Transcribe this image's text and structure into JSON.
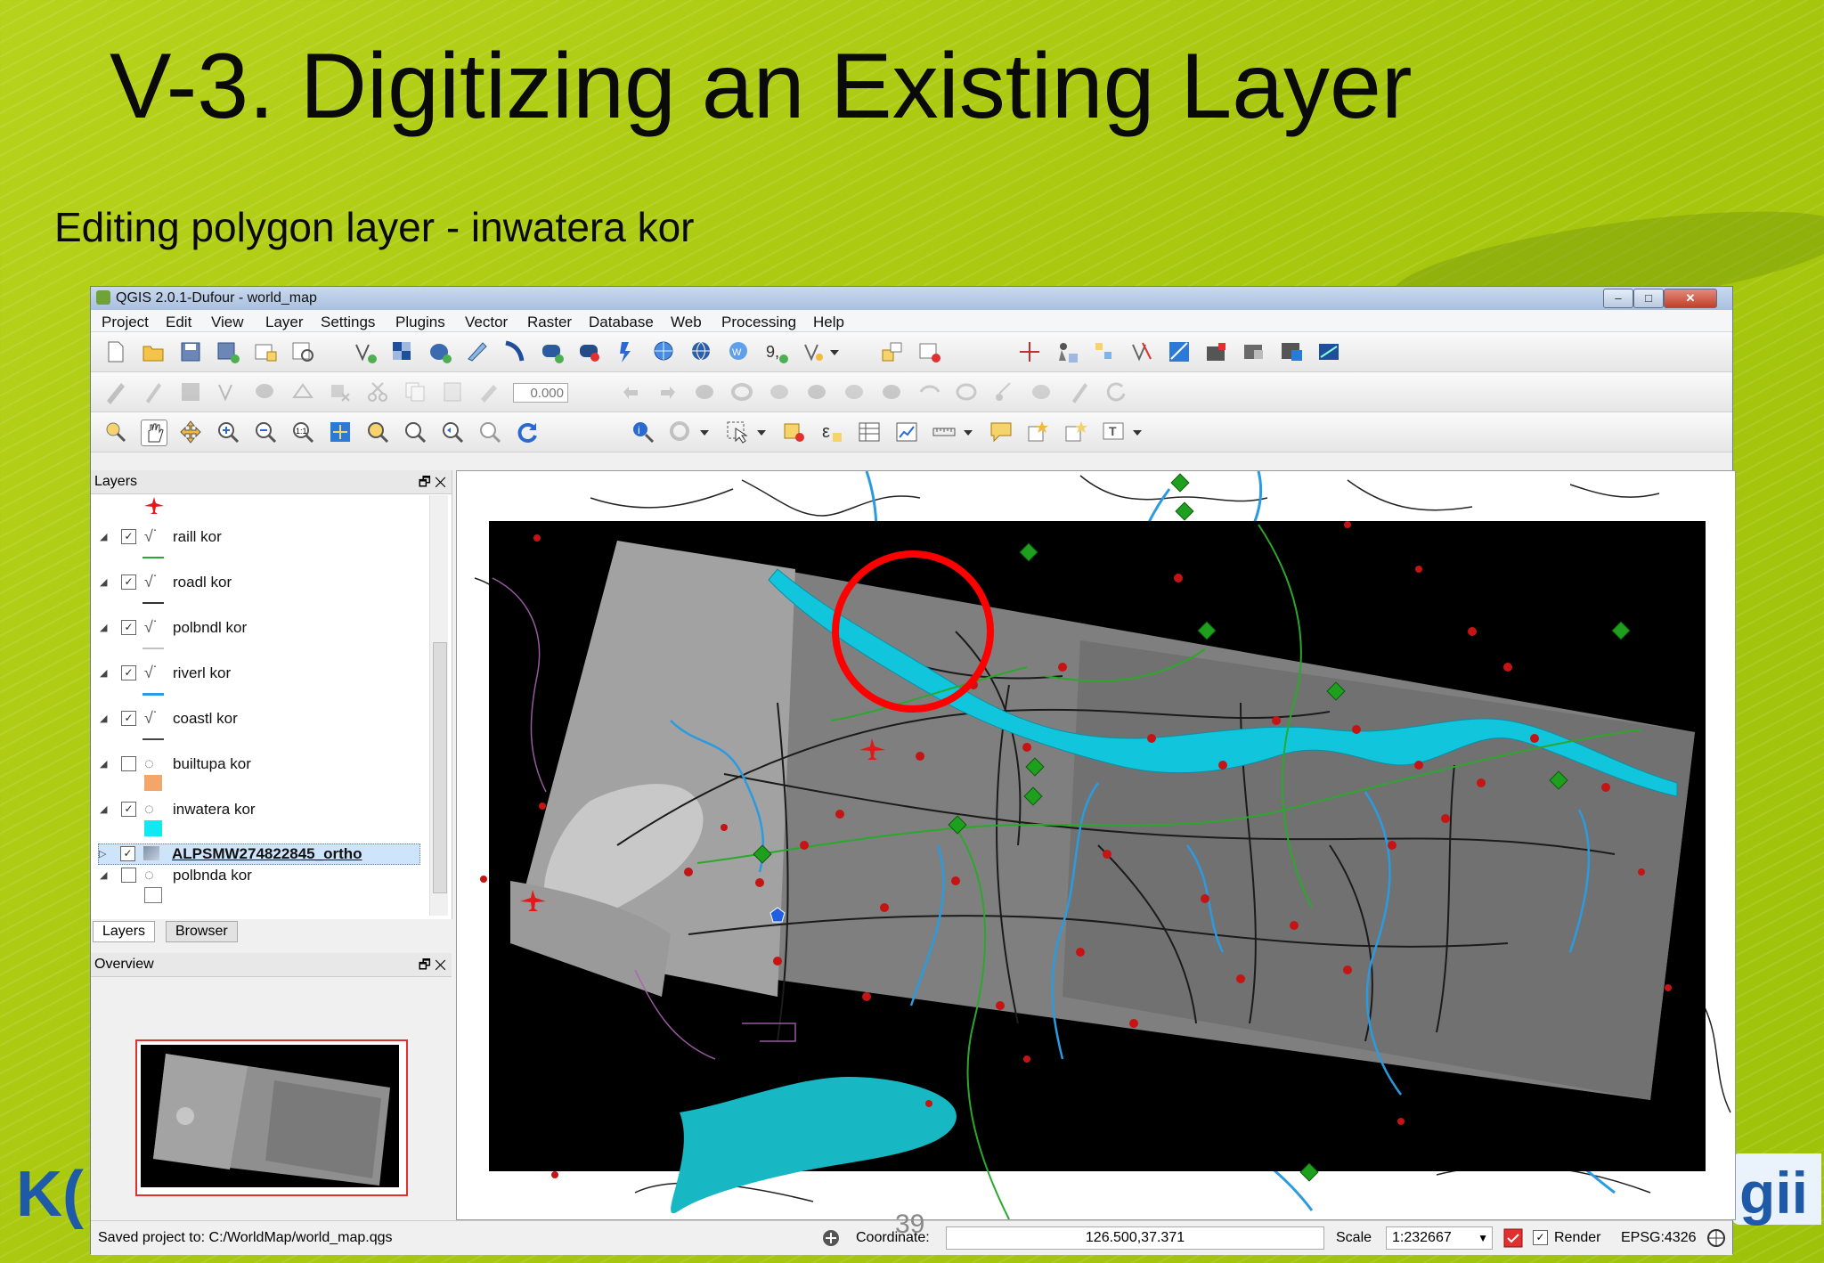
{
  "slide": {
    "title": "V-3. Digitizing an Existing Layer",
    "subtitle": "Editing polygon layer - inwatera kor",
    "logo_left": "K(",
    "logo_right": "gii",
    "page_number": "39"
  },
  "window": {
    "title": "QGIS 2.0.1-Dufour - world_map",
    "btn_min": "–",
    "btn_max": "□",
    "btn_close": "✕"
  },
  "menu": [
    "Project",
    "Edit",
    "View",
    "Layer",
    "Settings",
    "Plugins",
    "Vector",
    "Raster",
    "Database",
    "Web",
    "Processing",
    "Help"
  ],
  "toolbar": {
    "rotation_value": "0.000"
  },
  "layers_panel": {
    "title": "Layers",
    "controls": "🗗 ✕",
    "layers": [
      {
        "name": "raill kor",
        "checked": "✓",
        "legend_color": "#2ba82b"
      },
      {
        "name": "roadl kor",
        "checked": "✓",
        "legend_color": "#333333"
      },
      {
        "name": "polbndl kor",
        "checked": "✓",
        "legend_color": "#c0c0c0"
      },
      {
        "name": "riverl kor",
        "checked": "✓",
        "legend_color": "#2a9be0"
      },
      {
        "name": "coastl kor",
        "checked": "✓",
        "legend_color": "#444444"
      },
      {
        "name": "builtupa kor",
        "checked": "",
        "legend_color": "#f4a66a"
      },
      {
        "name": "inwatera kor",
        "checked": "✓",
        "legend_color": "#11e8f0"
      },
      {
        "name": "ALPSMW274822845_ortho",
        "checked": "✓",
        "legend_color": ""
      },
      {
        "name": "polbnda kor",
        "checked": "",
        "legend_color": "#ffffff"
      }
    ],
    "tab_layers": "Layers",
    "tab_browser": "Browser"
  },
  "overview_panel": {
    "title": "Overview",
    "controls": "🗗 ✕"
  },
  "statusbar": {
    "message": "Saved project to: C:/WorldMap/world_map.qgs",
    "coordinate_label": "Coordinate:",
    "coordinate_value": "126.500,37.371",
    "scale_label": "Scale",
    "scale_value": "1:232667",
    "render_label": "Render",
    "crs": "EPSG:4326"
  },
  "colors": {
    "accent_green": "#a9c80f",
    "selection": "#cde4fb",
    "inwater": "#11e8f0"
  }
}
